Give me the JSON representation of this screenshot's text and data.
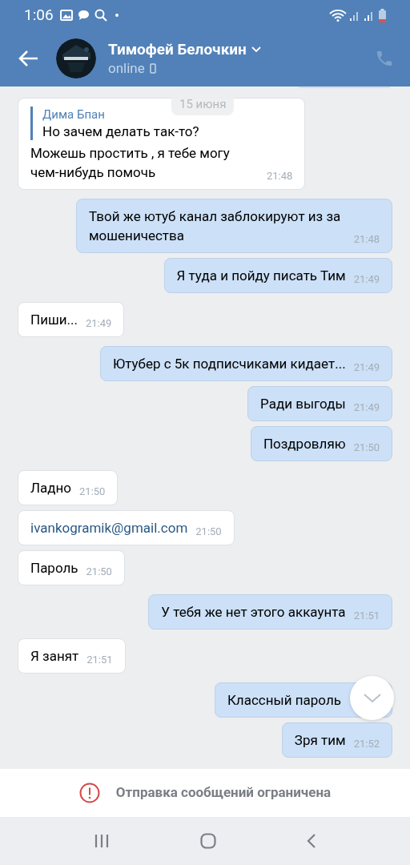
{
  "status_bar": {
    "time": "1:06"
  },
  "header": {
    "name": "Тимофей Белочкин",
    "status": "online",
    "call_disabled": true
  },
  "date_label": "15 июня",
  "messages": [
    {
      "kind": "text",
      "outgoing": false,
      "reply": {
        "author": "Дима Бпан",
        "text": "Но зачем делать так-то?"
      },
      "text": "Можешь простить , я тебе могу чем-нибудь помочь",
      "time": "21:48"
    },
    {
      "kind": "text",
      "outgoing": true,
      "text": "Твой же ютуб канал заблокируют из за мошеничества",
      "time": "21:48"
    },
    {
      "kind": "text",
      "outgoing": true,
      "text": "Я туда и пойду писать Тим",
      "time": "21:49"
    },
    {
      "kind": "text",
      "outgoing": false,
      "text": "Пиши...",
      "time": "21:49"
    },
    {
      "kind": "text",
      "outgoing": true,
      "text": "Ютубер с 5к подписчиками кидает...",
      "time": "21:49"
    },
    {
      "kind": "text",
      "outgoing": true,
      "text": "Ради выгоды",
      "time": "21:49"
    },
    {
      "kind": "text",
      "outgoing": true,
      "text": "Поздровляю",
      "time": "21:50"
    },
    {
      "kind": "text",
      "outgoing": false,
      "text": "Ладно",
      "time": "21:50"
    },
    {
      "kind": "link",
      "outgoing": false,
      "text": "ivankogramik@gmail.com",
      "time": "21:50"
    },
    {
      "kind": "text",
      "outgoing": false,
      "text": "Пароль",
      "time": "21:50"
    },
    {
      "kind": "text",
      "outgoing": true,
      "text": "У тебя же нет этого аккаунта",
      "time": "21:51"
    },
    {
      "kind": "text",
      "outgoing": false,
      "text": "Я занят",
      "time": "21:51"
    },
    {
      "kind": "text",
      "outgoing": true,
      "text": "Классный пароль"
    },
    {
      "kind": "text",
      "outgoing": true,
      "text": "Зря тим",
      "time": "21:52"
    }
  ],
  "restriction_notice": "Отправка сообщений ограничена"
}
